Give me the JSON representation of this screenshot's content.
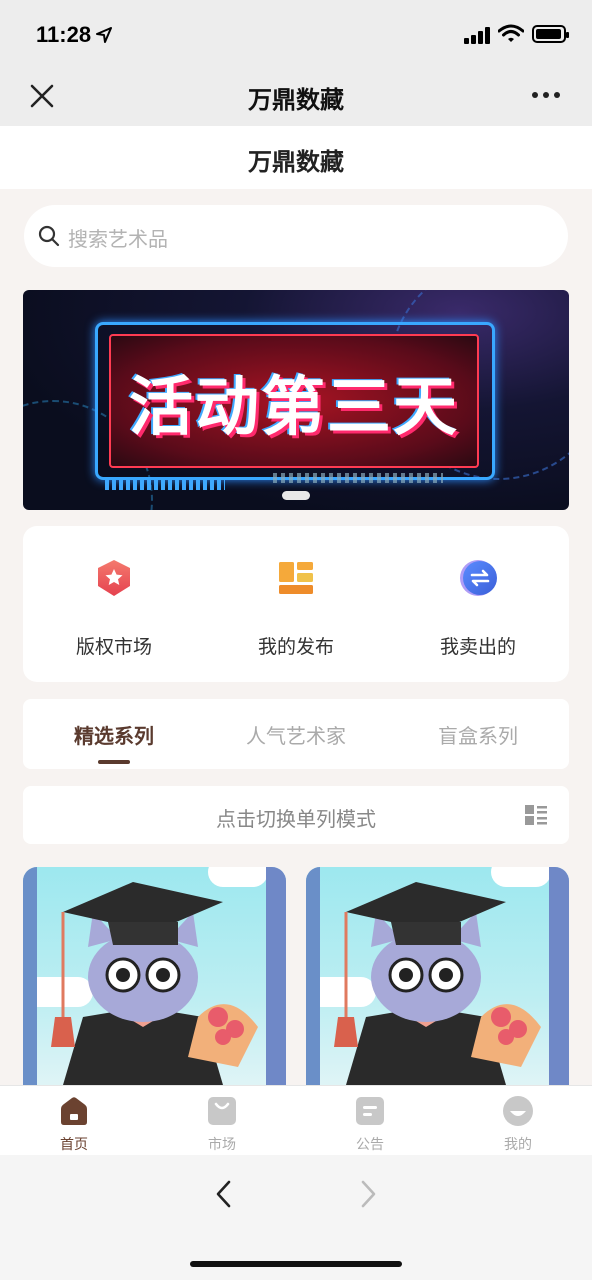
{
  "status_bar": {
    "time": "11:28"
  },
  "nav": {
    "title": "万鼎数藏",
    "close_icon": "close-icon",
    "more_icon": "more-icon"
  },
  "header": {
    "title": "万鼎数藏"
  },
  "search": {
    "placeholder": "搜索艺术品"
  },
  "banner": {
    "headline": "活动第三天"
  },
  "quick_menu": [
    {
      "label": "版权市场",
      "icon": "shield-star-icon",
      "color": "#e9545a"
    },
    {
      "label": "我的发布",
      "icon": "layout-blocks-icon",
      "color": "#f2a03a"
    },
    {
      "label": "我卖出的",
      "icon": "exchange-circle-icon",
      "color": "#4a7cf0"
    }
  ],
  "tabs": [
    {
      "label": "精选系列",
      "active": true
    },
    {
      "label": "人气艺术家",
      "active": false
    },
    {
      "label": "盲盒系列",
      "active": false
    }
  ],
  "view_toggle": {
    "label": "点击切换单列模式",
    "icon": "list-grid-icon"
  },
  "tabbar": [
    {
      "label": "首页",
      "icon": "home-icon",
      "active": true
    },
    {
      "label": "市场",
      "icon": "shopping-bag-icon",
      "active": false
    },
    {
      "label": "公告",
      "icon": "notice-icon",
      "active": false
    },
    {
      "label": "我的",
      "icon": "profile-icon",
      "active": false
    }
  ],
  "colors": {
    "accent": "#5a3a2e",
    "page_bg": "#f7f3f1"
  }
}
